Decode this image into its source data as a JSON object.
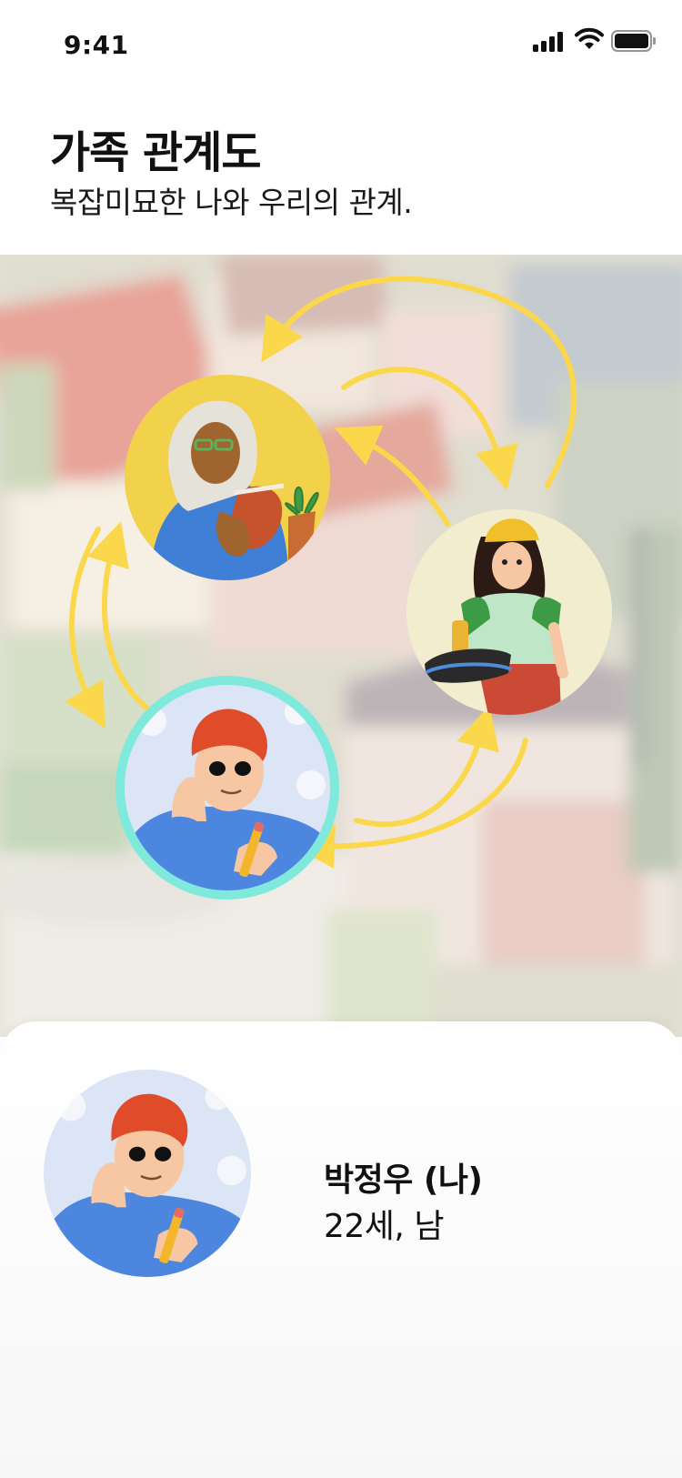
{
  "status_bar": {
    "time": "9:41",
    "icons": [
      "signal-icon",
      "wifi-icon",
      "battery-icon"
    ]
  },
  "header": {
    "title": "가족 관계도",
    "subtitle": "복잡미묘한 나와 우리의 관계."
  },
  "relationship_map": {
    "arrow_color": "#FBD84B",
    "nodes": [
      {
        "id": "mother",
        "avatar_bg": "#F2D24A"
      },
      {
        "id": "sibling",
        "avatar_bg": "#F3EDCF"
      },
      {
        "id": "me",
        "avatar_bg": "#D9E3F5",
        "ring_color": "#7FE9DC",
        "selected": true
      }
    ]
  },
  "profile": {
    "name": "박정우 (나)",
    "info": "22세, 남"
  }
}
